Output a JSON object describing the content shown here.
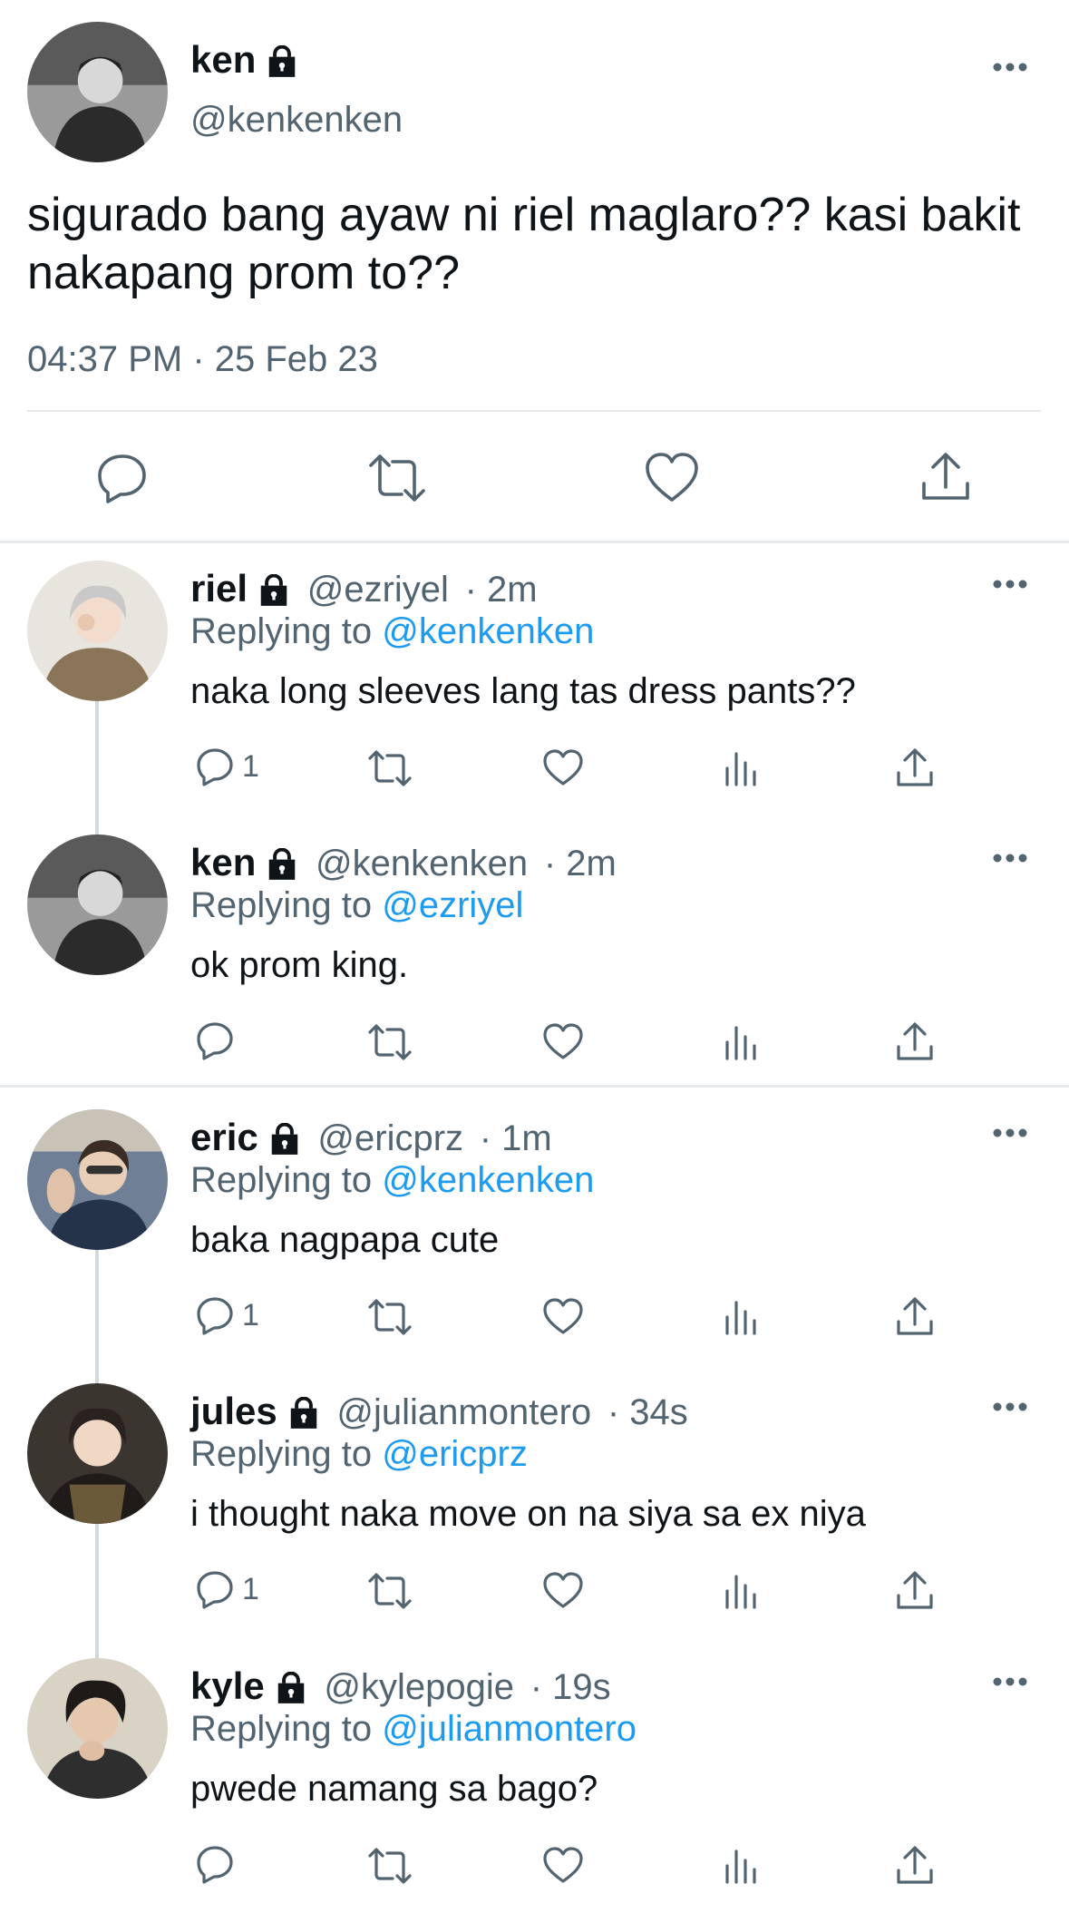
{
  "colors": {
    "accent": "#1d9bf0",
    "muted": "#536471",
    "text": "#0f1419"
  },
  "main_tweet": {
    "name": "ken",
    "handle": "@kenkenken",
    "text": "sigurado bang ayaw ni riel maglaro?? kasi bakit nakapang prom to??",
    "timestamp": "04:37 PM · 25 Feb 23",
    "actions": [
      "reply-icon",
      "retweet-icon",
      "like-icon",
      "share-icon"
    ]
  },
  "replies": [
    {
      "name": "riel",
      "handle": "@ezriyel",
      "time": "· 2m",
      "replying_prefix": "Replying to",
      "replying_to": "@kenkenken",
      "text": "naka long sleeves lang tas dress pants??",
      "reply_count": "1"
    },
    {
      "name": "ken",
      "handle": "@kenkenken",
      "time": "· 2m",
      "replying_prefix": "Replying to",
      "replying_to": "@ezriyel",
      "text": "ok prom king.",
      "reply_count": ""
    },
    {
      "name": "eric",
      "handle": "@ericprz",
      "time": "· 1m",
      "replying_prefix": "Replying to",
      "replying_to": "@kenkenken",
      "text": "baka nagpapa cute",
      "reply_count": "1"
    },
    {
      "name": "jules",
      "handle": "@julianmontero",
      "time": "· 34s",
      "replying_prefix": "Replying to",
      "replying_to": "@ericprz",
      "text": "i thought naka move on na siya sa ex niya",
      "reply_count": "1"
    },
    {
      "name": "kyle",
      "handle": "@kylepogie",
      "time": "· 19s",
      "replying_prefix": "Replying to",
      "replying_to": "@julianmontero",
      "text": "pwede namang sa bago?",
      "reply_count": ""
    }
  ]
}
